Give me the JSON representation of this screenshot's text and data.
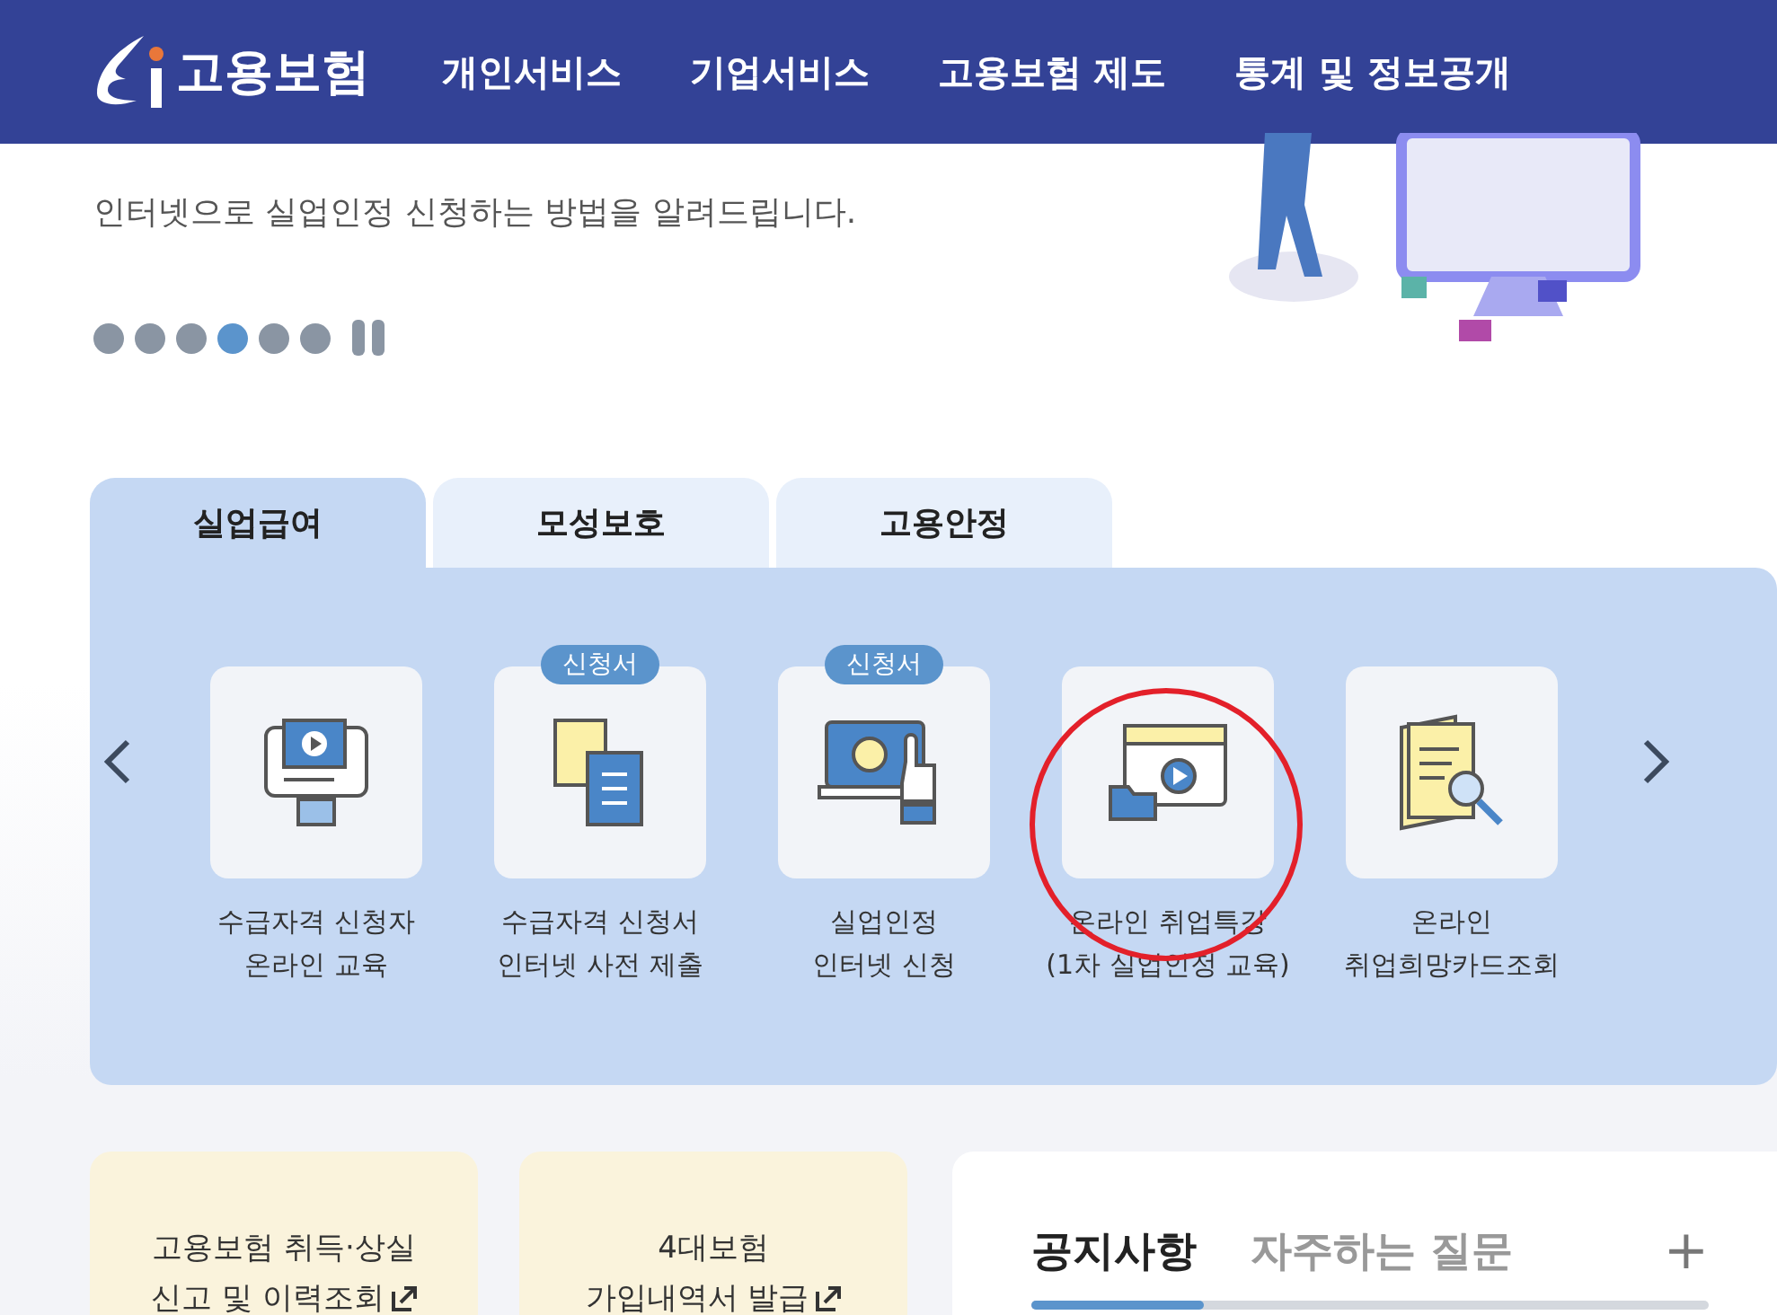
{
  "header": {
    "logo": "고용보험",
    "nav": [
      "개인서비스",
      "기업서비스",
      "고용보험 제도",
      "통계 및 정보공개"
    ]
  },
  "hero": {
    "subtitle": "인터넷으로 실업인정 신청하는 방법을 알려드립니다.",
    "dots": [
      {
        "selected": false
      },
      {
        "selected": false
      },
      {
        "selected": false
      },
      {
        "selected": true
      },
      {
        "selected": false
      },
      {
        "selected": false
      }
    ]
  },
  "tabs": [
    {
      "label": "실업급여",
      "selected": true
    },
    {
      "label": "모성보호",
      "selected": false
    },
    {
      "label": "고용안정",
      "selected": false
    }
  ],
  "services": [
    {
      "kind": "monitor",
      "lines": [
        "수급자격 신청자",
        "온라인 교육"
      ],
      "highlighted": false
    },
    {
      "kind": "documents",
      "badge": "신청서",
      "lines": [
        "수급자격 신청서",
        "인터넷 사전 제출"
      ],
      "highlighted": false
    },
    {
      "kind": "laptop",
      "badge": "신청서",
      "lines": [
        "실업인정",
        "인터넷 신청"
      ],
      "highlighted": false
    },
    {
      "kind": "video",
      "lines": [
        "온라인 취업특강",
        "(1차 실업인정 교육)"
      ],
      "highlighted": true
    },
    {
      "kind": "search",
      "lines": [
        "온라인",
        "취업희망카드조회"
      ],
      "highlighted": false
    }
  ],
  "quick_links": [
    {
      "lines": [
        "고용보험 취득·상실",
        "신고 및 이력조회"
      ]
    },
    {
      "lines": [
        "4대보험",
        "가입내역서 발급"
      ]
    }
  ],
  "board": {
    "tabs": [
      {
        "label": "공지사항",
        "selected": true
      },
      {
        "label": "자주하는 질문",
        "selected": false
      }
    ],
    "more": "+"
  }
}
